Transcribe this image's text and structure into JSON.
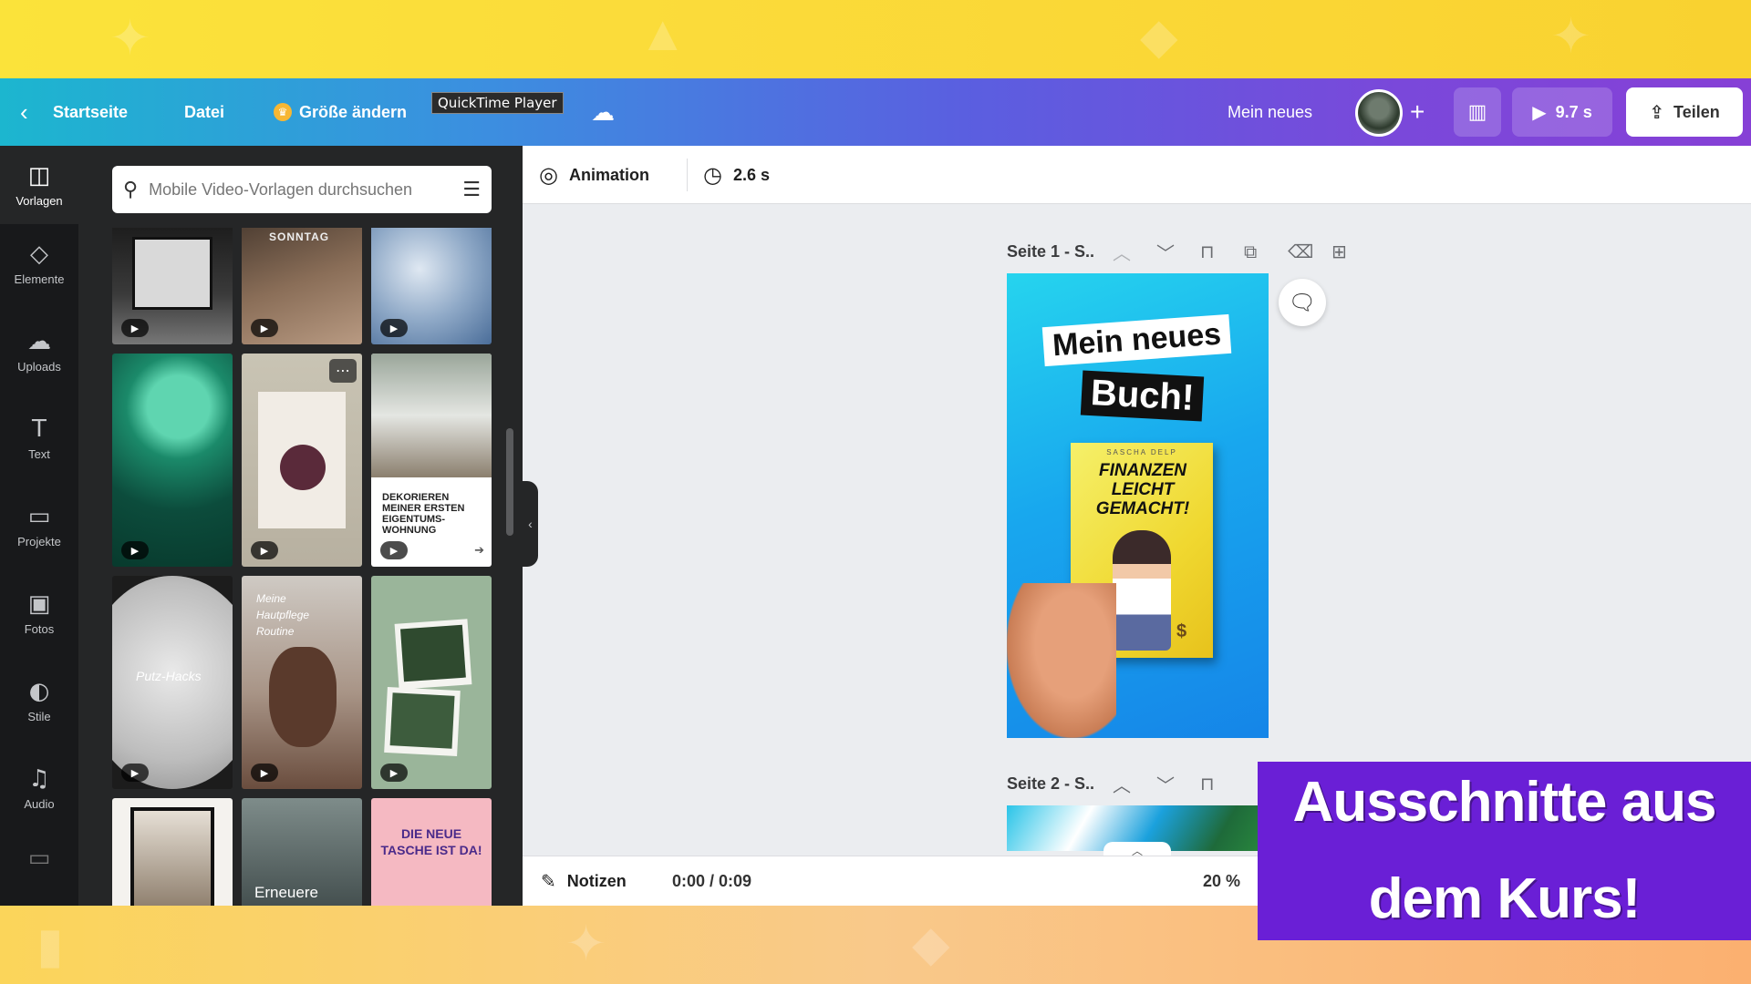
{
  "topbar": {
    "back_icon": "chevron-left-icon",
    "home": "Startseite",
    "file": "Datei",
    "resize": "Größe ändern",
    "tooltip": "QuickTime Player",
    "title": "Mein neues",
    "play_duration": "9.7 s",
    "share": "Teilen",
    "colors": {
      "gradient_start": "#1cb6cf",
      "gradient_end": "#8640d6"
    }
  },
  "rail": {
    "items": [
      {
        "label": "Vorlagen",
        "icon": "template-icon"
      },
      {
        "label": "Elemente",
        "icon": "elements-icon"
      },
      {
        "label": "Uploads",
        "icon": "upload-cloud-icon"
      },
      {
        "label": "Text",
        "icon": "text-icon"
      },
      {
        "label": "Projekte",
        "icon": "folder-icon"
      },
      {
        "label": "Fotos",
        "icon": "photo-icon"
      },
      {
        "label": "Stile",
        "icon": "palette-icon"
      },
      {
        "label": "Audio",
        "icon": "music-note-icon"
      }
    ]
  },
  "panel": {
    "search_placeholder": "Mobile Video-Vorlagen durchsuchen",
    "thumb_texts": {
      "sonntag": "SONNTAG",
      "dekorieren": "DEKORIEREN MEINER ERSTEN EIGENTUMS-WOHNUNG",
      "routine": "Meine Hautpflege Routine",
      "putz": "Putz-Hacks",
      "erneuere": "Erneuere",
      "tasche": "DIE NEUE TASCHE IST DA!"
    }
  },
  "toolbar": {
    "animation": "Animation",
    "duration": "2.6 s"
  },
  "pages": [
    {
      "label": "Seite 1 - S.."
    },
    {
      "label": "Seite 2 - S.."
    }
  ],
  "design": {
    "title_line1": "Mein neues",
    "title_line2": "Buch!",
    "book_author": "SASCHA DELP",
    "book_title": "FINANZEN LEICHT GEMACHT!"
  },
  "footer": {
    "notes": "Notizen",
    "time": "0:00 / 0:09",
    "zoom": "20 %"
  },
  "banner": {
    "line1": "Ausschnitte aus",
    "line2": "dem Kurs!",
    "color": "#6a1fd6"
  }
}
